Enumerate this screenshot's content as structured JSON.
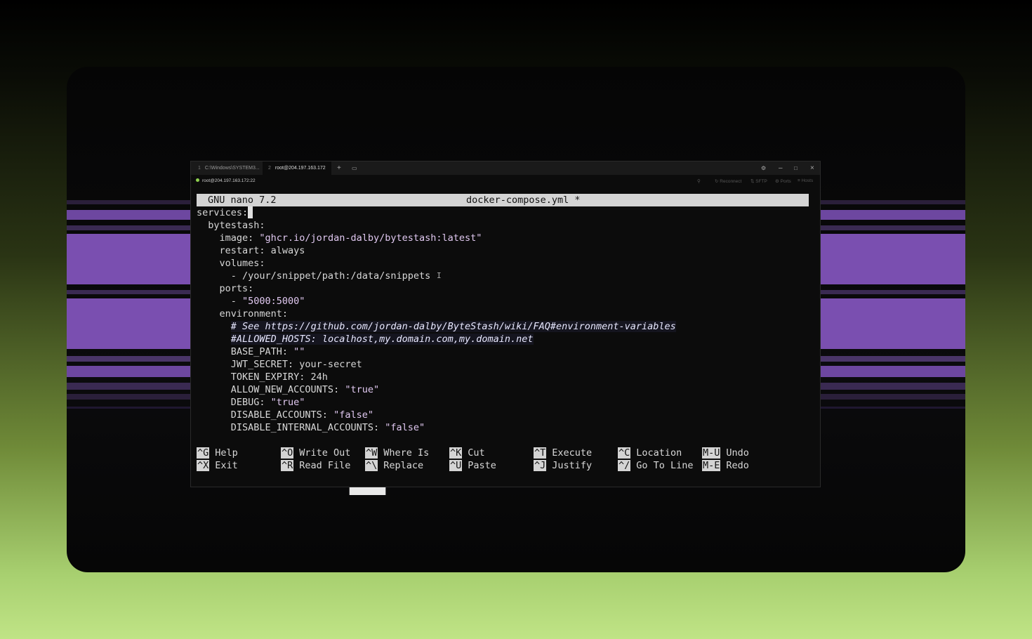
{
  "colors": {
    "stripe_purple": "#7a4fb0",
    "stripe_dark": "#1a1422",
    "terminal_bg": "#0c0c0c",
    "status_dot": "#8fd14f",
    "nano_bar": "#d4d4d4"
  },
  "tabs": [
    {
      "index": "1",
      "label": "C:\\Windows\\SYSTEM3..."
    },
    {
      "index": "2",
      "label": "root@204.197.163.172"
    }
  ],
  "window_controls": {
    "new_tab_icon": "plus-icon",
    "tabs_icon": "tabs-icon",
    "settings_icon": "gear-icon",
    "minimize_icon": "minimize-icon",
    "maximize_icon": "maximize-icon",
    "close_icon": "close-icon"
  },
  "status": {
    "connection": "root@204.197.163.172:22",
    "reconnect": "Reconnect",
    "sftp": "SFTP",
    "ports": "Ports",
    "more": "Hosts"
  },
  "nano": {
    "version": "GNU nano 7.2",
    "filename": "docker-compose.yml *",
    "lines": [
      {
        "text": "services:",
        "cursor": true
      },
      {
        "text": "  bytestash:"
      },
      {
        "key": "    image: ",
        "str": "\"ghcr.io/jordan-dalby/bytestash:latest\""
      },
      {
        "text": "    restart: always"
      },
      {
        "text": "    volumes:"
      },
      {
        "text": "      - /your/snippet/path:/data/snippets",
        "ibeam": true
      },
      {
        "text": "    ports:"
      },
      {
        "key": "      - ",
        "str": "\"5000:5000\""
      },
      {
        "text": "    environment:"
      },
      {
        "indent": "      ",
        "comment": "# See https://github.com/jordan-dalby/ByteStash/wiki/FAQ#environment-variables"
      },
      {
        "indent": "      ",
        "comment": "#ALLOWED_HOSTS: localhost,my.domain.com,my.domain.net"
      },
      {
        "key": "      BASE_PATH: ",
        "str": "\"\""
      },
      {
        "text": "      JWT_SECRET: your-secret"
      },
      {
        "text": "      TOKEN_EXPIRY: 24h"
      },
      {
        "key": "      ALLOW_NEW_ACCOUNTS: ",
        "str": "\"true\""
      },
      {
        "key": "      DEBUG: ",
        "str": "\"true\""
      },
      {
        "key": "      DISABLE_ACCOUNTS: ",
        "str": "\"false\""
      },
      {
        "key": "      DISABLE_INTERNAL_ACCOUNTS: ",
        "str": "\"false\""
      }
    ],
    "shortcuts": [
      {
        "key": "^G",
        "label": "Help"
      },
      {
        "key": "^X",
        "label": "Exit"
      },
      {
        "key": "^O",
        "label": "Write Out"
      },
      {
        "key": "^R",
        "label": "Read File"
      },
      {
        "key": "^W",
        "label": "Where Is"
      },
      {
        "key": "^\\",
        "label": "Replace"
      },
      {
        "key": "^K",
        "label": "Cut"
      },
      {
        "key": "^U",
        "label": "Paste"
      },
      {
        "key": "^T",
        "label": "Execute"
      },
      {
        "key": "^J",
        "label": "Justify"
      },
      {
        "key": "^C",
        "label": "Location"
      },
      {
        "key": "^/",
        "label": "Go To Line"
      },
      {
        "key": "M-U",
        "label": "Undo"
      },
      {
        "key": "M-E",
        "label": "Redo"
      }
    ]
  }
}
